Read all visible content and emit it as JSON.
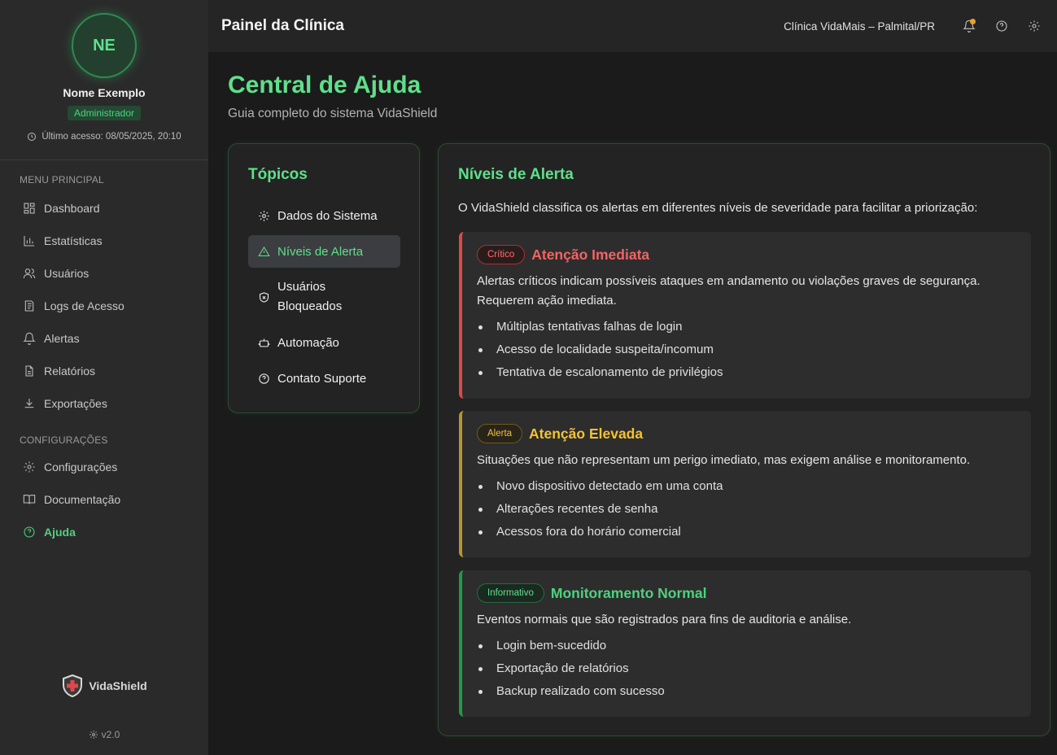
{
  "sidebar": {
    "profile": {
      "initials": "NE",
      "name": "Nome Exemplo",
      "role": "Administrador",
      "last_access": "Último acesso: 08/05/2025, 20:10"
    },
    "sections": [
      {
        "title": "MENU PRINCIPAL",
        "items": [
          {
            "label": "Dashboard",
            "icon": "dashboard-icon"
          },
          {
            "label": "Estatísticas",
            "icon": "bar-chart-icon"
          },
          {
            "label": "Usuários",
            "icon": "users-icon"
          },
          {
            "label": "Logs de Acesso",
            "icon": "logs-icon"
          },
          {
            "label": "Alertas",
            "icon": "bell-icon"
          },
          {
            "label": "Relatórios",
            "icon": "file-icon"
          },
          {
            "label": "Exportações",
            "icon": "download-icon"
          }
        ]
      },
      {
        "title": "CONFIGURAÇÕES",
        "items": [
          {
            "label": "Configurações",
            "icon": "gear-icon"
          },
          {
            "label": "Documentação",
            "icon": "book-icon"
          },
          {
            "label": "Ajuda",
            "icon": "help-circle-icon",
            "active": true
          }
        ]
      }
    ],
    "brand": "VidaShield",
    "version": "v2.0"
  },
  "header": {
    "title": "Painel da Clínica",
    "clinic": "Clínica VidaMais – Palmital/PR",
    "icons": [
      "bell-icon",
      "help-circle-icon",
      "gear-icon"
    ],
    "notification_color": "#f0a020"
  },
  "page": {
    "title": "Central de Ajuda",
    "subtitle": "Guia completo do sistema VidaShield"
  },
  "topics": {
    "title": "Tópicos",
    "items": [
      {
        "label": "Dados do Sistema",
        "icon": "gear-icon"
      },
      {
        "label": "Níveis de Alerta",
        "icon": "warning-triangle-icon",
        "active": true
      },
      {
        "label": "Usuários Bloqueados",
        "icon": "shield-x-icon"
      },
      {
        "label": "Automação",
        "icon": "robot-icon"
      },
      {
        "label": "Contato Suporte",
        "icon": "help-circle-icon"
      }
    ]
  },
  "content": {
    "title": "Níveis de Alerta",
    "intro": "O VidaShield classifica os alertas em diferentes níveis de severidade para facilitar a priorização:",
    "levels": [
      {
        "badge": "Crítico",
        "title": "Atenção Imediata",
        "description": "Alertas críticos indicam possíveis ataques em andamento ou violações graves de segurança. Requerem ação imediata.",
        "items": [
          "Múltiplas tentativas falhas de login",
          "Acesso de localidade suspeita/incomum",
          "Tentativa de escalonamento de privilégios"
        ],
        "color": "#e04848"
      },
      {
        "badge": "Alerta",
        "title": "Atenção Elevada",
        "description": "Situações que não representam um perigo imediato, mas exigem análise e monitoramento.",
        "items": [
          "Novo dispositivo detectado em uma conta",
          "Alterações recentes de senha",
          "Acessos fora do horário comercial"
        ],
        "color": "#f4c32f"
      },
      {
        "badge": "Informativo",
        "title": "Monitoramento Normal",
        "description": "Eventos normais que são registrados para fins de auditoria e análise.",
        "items": [
          "Login bem-sucedido",
          "Exportação de relatórios",
          "Backup realizado com sucesso"
        ],
        "color": "#4fd17e"
      }
    ]
  },
  "colors": {
    "accent": "#5ee08b",
    "sidebar_bg": "#2a2a2a",
    "page_bg": "#1b1b1b"
  }
}
